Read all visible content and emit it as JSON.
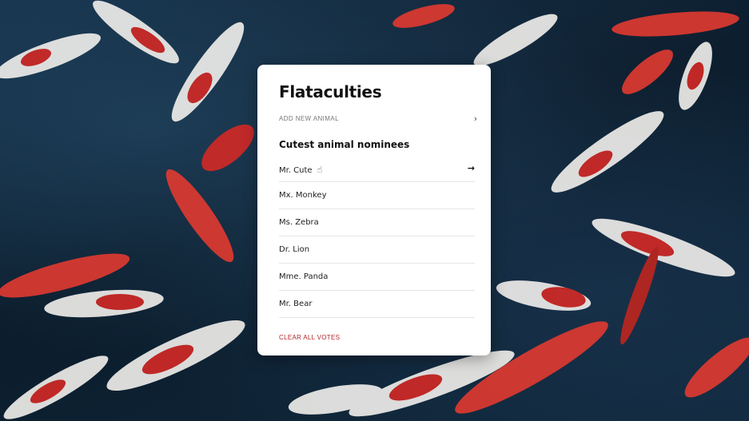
{
  "app": {
    "title": "Flataculties"
  },
  "actions": {
    "add_label": "ADD NEW ANIMAL",
    "clear_label": "CLEAR ALL VOTES"
  },
  "section": {
    "title": "Cutest animal nominees"
  },
  "nominees": [
    {
      "label": "Mr. Cute"
    },
    {
      "label": "Mx. Monkey"
    },
    {
      "label": "Ms. Zebra"
    },
    {
      "label": "Dr. Lion"
    },
    {
      "label": "Mme. Panda"
    },
    {
      "label": "Mr. Bear"
    }
  ],
  "icons": {
    "add_chevron": "chevron-right-icon",
    "row_arrow": "arrow-right-icon"
  },
  "colors": {
    "accent": "#b3262a",
    "card_bg": "#ffffff"
  }
}
